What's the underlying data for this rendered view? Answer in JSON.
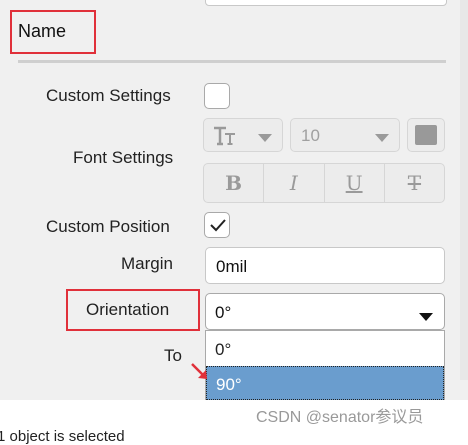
{
  "section": {
    "title": "Name"
  },
  "labels": {
    "custom_settings": "Custom Settings",
    "font_settings": "Font Settings",
    "custom_position": "Custom Position",
    "margin": "Margin",
    "orientation": "Orientation",
    "to": "To"
  },
  "custom_settings_checked": false,
  "custom_position_checked": true,
  "font": {
    "size_value": "10",
    "color": "#999999"
  },
  "style_buttons": {
    "bold": "B",
    "italic": "I",
    "underline": "U",
    "strike": "T"
  },
  "margin": {
    "value": "0mil"
  },
  "orientation": {
    "selected": "0°",
    "options": [
      "0°",
      "90°"
    ],
    "highlighted_option": "90°"
  },
  "colors": {
    "highlight_box": "#e0303a",
    "option_highlight": "#6a9dce"
  },
  "watermark": "CSDN @senator参议员",
  "footer_text": "1 object is selected"
}
